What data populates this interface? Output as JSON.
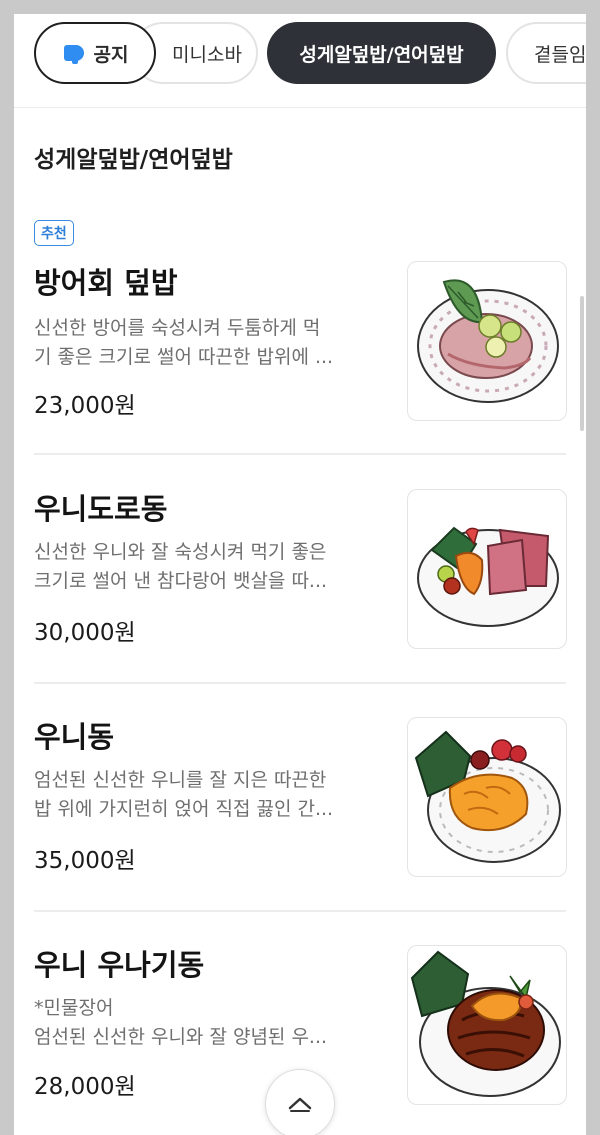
{
  "tabs": {
    "notice": "공지",
    "items": [
      "미니소바",
      "성게알덮밥/연어덮밥",
      "곁들임메"
    ],
    "active_index": 1
  },
  "section_title": "성게알덮밥/연어덮밥",
  "menu": [
    {
      "badge": "추천",
      "name": "방어회 덮밥",
      "desc_line1": "신선한 방어를 숙성시켜 두툼하게 먹",
      "desc_line2": "기 좋은 크기로 썰어 따끈한 밥위에 ...",
      "price": "23,000원",
      "image": "yellowtail-bowl-illustration"
    },
    {
      "name": "우니도로동",
      "desc_line1": "신선한 우니와 잘 숙성시켜 먹기 좋은",
      "desc_line2": "크기로 썰어 낸 참다랑어 뱃살을 따...",
      "price": "30,000원",
      "image": "uni-toro-bowl-illustration"
    },
    {
      "name": "우니동",
      "desc_line1": "엄선된 신선한 우니를 잘 지은 따끈한",
      "desc_line2": "밥 위에 가지런히 얹어 직접 끓인 간...",
      "price": "35,000원",
      "image": "uni-bowl-illustration"
    },
    {
      "name": "우니 우나기동",
      "desc_line1": "*민물장어",
      "desc_line2": "엄선된 신선한 우니와 잘 양념된 우...",
      "price": "28,000원",
      "image": "uni-eel-bowl-illustration"
    }
  ],
  "scroll_top_icon": "chevron-up-icon",
  "colors": {
    "active_tab": "#2e3137",
    "badge": "#2f7fd6",
    "notice_icon": "#2f8cf0"
  }
}
